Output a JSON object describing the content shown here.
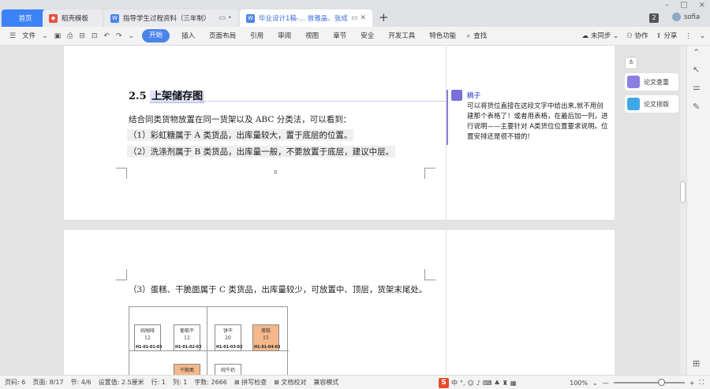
{
  "titlebar": {
    "tabs": [
      {
        "label": "首页"
      },
      {
        "label": "稻壳模板"
      },
      {
        "label": "指导学生过程资料（三年制）"
      },
      {
        "label": "毕业设计1稿-... 曾雅晶、张成"
      }
    ],
    "new_tab": "+",
    "window_controls": [
      "–",
      "□",
      "×"
    ],
    "badge_count": "2",
    "user_name": "sofia"
  },
  "menubar": {
    "file": "文件",
    "start": "开始",
    "items": [
      "插入",
      "页面布局",
      "引用",
      "审阅",
      "视图",
      "章节",
      "安全",
      "开发工具",
      "特色功能",
      "查找"
    ],
    "right": [
      "未同步",
      "协作",
      "分享"
    ]
  },
  "doc": {
    "heading_num": "2.5",
    "heading_text": "上架储存图",
    "para1": "结合同类货物放置在同一货架以及 ABC 分类法，可以看到：",
    "para2": "（1）彩虹糖属于 A 类货品，出库量较大，置于底层的位置。",
    "para3": "（2）洗涤剂属于 B 类货品，出库量一般，不要放置于底层，建议中层。",
    "page_number": "6",
    "para4": "（3）蛋糕、干脆面属于 C 类货品，出库量较少，可放置中、顶层，货架末尾处。",
    "diagram": {
      "cells": [
        {
          "name": "纯咖啡",
          "qty": "12",
          "code": "H1-01-01-03"
        },
        {
          "name": "葡萄干",
          "qty": "12",
          "code": "H1-01-02-03"
        },
        {
          "name": "饼干",
          "qty": "20",
          "code": "H1-01-03-03"
        },
        {
          "name": "蛋糕",
          "qty": "15",
          "code": "H1-01-04-03"
        }
      ],
      "row2": [
        {
          "name": "干脆面"
        },
        {
          "name": "纯牛奶"
        }
      ]
    }
  },
  "comment": {
    "author": "桃子",
    "text": "可以将货位直接在这段文字中给出来,就不用创建那个表格了！或者用表格，在最后加一列，进行说明——主要针对 A类货位位置要求说明。位置安排还是很不错的!"
  },
  "side": {
    "btn1": "论文查重",
    "btn2": "论文排版"
  },
  "status": {
    "page_code": "页码: 6",
    "page": "页面: 8/17",
    "section": "节: 4/6",
    "setting": "设置值: 2.5厘米",
    "row": "行: 1",
    "col": "列: 1",
    "words": "字数: 2666",
    "spell": "拼写检查",
    "proof": "文档校对",
    "compat": "兼容模式",
    "ime_lang": "中",
    "zoom": "100%"
  },
  "colors": {
    "accent": "#4a84e8",
    "ime": "#e84b2c",
    "orange_cell": "#f4b88a",
    "comment_bar": "#8a7fd8"
  }
}
